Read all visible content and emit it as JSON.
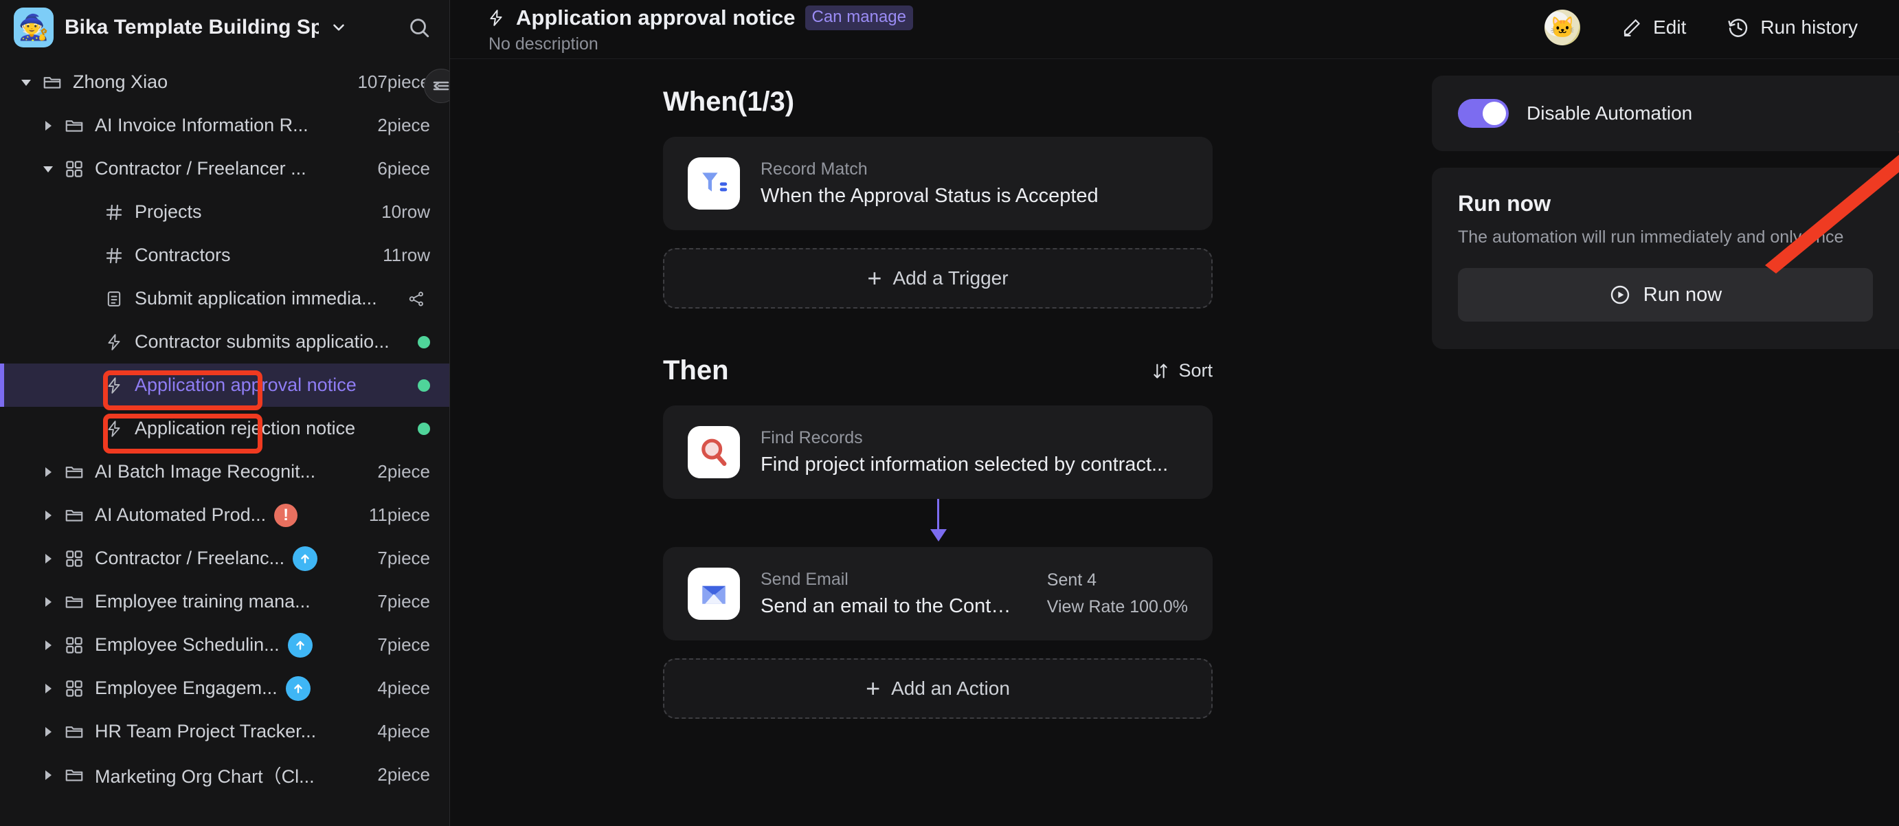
{
  "sidebar": {
    "workspace": {
      "title": "Bika Template Building Sp...",
      "avatar_icon": "wizard-emoji",
      "chevron_icon": "chevron-down-icon",
      "search_icon": "search-icon"
    },
    "collapse_icon": "collapse-sidebar-icon",
    "items": [
      {
        "label": "Zhong Xiao",
        "count": "107piece",
        "icon": "folder-icon",
        "twisty": "expanded",
        "indent": 0
      },
      {
        "label": "AI Invoice Information R...",
        "count": "2piece",
        "icon": "folder-icon",
        "twisty": "collapsed",
        "indent": 1
      },
      {
        "label": "Contractor / Freelancer ...",
        "count": "6piece",
        "icon": "grid-icon",
        "twisty": "expanded",
        "indent": 1
      },
      {
        "label": "Projects",
        "count": "10row",
        "icon": "table-icon",
        "twisty": "none",
        "indent": 2
      },
      {
        "label": "Contractors",
        "count": "11row",
        "icon": "table-icon",
        "twisty": "none",
        "indent": 2
      },
      {
        "label": "Submit application immedia...",
        "count": "",
        "icon": "form-icon",
        "twisty": "none",
        "indent": 2,
        "trailing": "share-icon"
      },
      {
        "label": "Contractor submits applicatio...",
        "count": "",
        "icon": "bolt-icon",
        "twisty": "none",
        "indent": 2,
        "trailing": "green-dot"
      },
      {
        "label": "Application approval notice",
        "count": "",
        "icon": "bolt-icon",
        "twisty": "none",
        "indent": 2,
        "trailing": "green-dot",
        "active": true,
        "highlighted": true
      },
      {
        "label": "Application rejection notice",
        "count": "",
        "icon": "bolt-icon",
        "twisty": "none",
        "indent": 2,
        "trailing": "green-dot",
        "highlighted": true
      },
      {
        "label": "AI Batch Image Recognit...",
        "count": "2piece",
        "icon": "folder-icon",
        "twisty": "collapsed",
        "indent": 1
      },
      {
        "label": "AI Automated Prod...",
        "count": "11piece",
        "icon": "folder-icon",
        "twisty": "collapsed",
        "indent": 1,
        "badge": "warn"
      },
      {
        "label": "Contractor / Freelanc...",
        "count": "7piece",
        "icon": "grid-icon",
        "twisty": "collapsed",
        "indent": 1,
        "badge": "up"
      },
      {
        "label": "Employee training mana...",
        "count": "7piece",
        "icon": "folder-icon",
        "twisty": "collapsed",
        "indent": 1
      },
      {
        "label": "Employee Schedulin...",
        "count": "7piece",
        "icon": "grid-icon",
        "twisty": "collapsed",
        "indent": 1,
        "badge": "up"
      },
      {
        "label": "Employee Engagem...",
        "count": "4piece",
        "icon": "grid-icon",
        "twisty": "collapsed",
        "indent": 1,
        "badge": "up"
      },
      {
        "label": "HR Team Project Tracker...",
        "count": "4piece",
        "icon": "folder-icon",
        "twisty": "collapsed",
        "indent": 1
      },
      {
        "label": "Marketing Org Chart（Cl...",
        "count": "2piece",
        "icon": "folder-icon",
        "twisty": "collapsed",
        "indent": 1
      }
    ]
  },
  "topbar": {
    "bolt_icon": "bolt-icon",
    "title": "Application approval notice",
    "tag": "Can manage",
    "description": "No description",
    "avatar_icon": "cat-avatar",
    "edit_label": "Edit",
    "edit_icon": "pencil-icon",
    "history_label": "Run history",
    "history_icon": "clock-history-icon"
  },
  "flow": {
    "when": {
      "title": "When(1/3)",
      "card": {
        "icon": "funnel-filter-icon",
        "subtitle": "Record Match",
        "title": "When the Approval Status is Accepted"
      },
      "add_label": "Add a Trigger",
      "add_icon": "plus-icon"
    },
    "then": {
      "title": "Then",
      "sort_label": "Sort",
      "sort_icon": "sort-icon",
      "cards": [
        {
          "icon": "magnifier-icon",
          "subtitle": "Find Records",
          "title": "Find project information selected by contract...",
          "stat1": "",
          "stat2": ""
        },
        {
          "icon": "envelope-icon",
          "subtitle": "Send Email",
          "title": "Send an email to the Contr...",
          "stat1": "Sent  4",
          "stat2": "View Rate 100.0%"
        }
      ],
      "add_label": "Add an Action",
      "add_icon": "plus-icon"
    }
  },
  "right_panel": {
    "toggle_label": "Disable Automation",
    "toggle_state": "on",
    "run_now_heading": "Run now",
    "run_now_desc": "The automation will run immediately and only once",
    "run_now_button": "Run now",
    "run_now_icon": "play-circle-icon"
  },
  "annotations": {
    "arrow_color": "#ef3b22",
    "highlight_color": "#f03a20",
    "arrow_icon": "pointer-arrow-annotation"
  },
  "colors": {
    "accent_purple": "#7c6cf0",
    "sidebar_bg": "#151516",
    "panel_bg": "#1b1b1d",
    "card_bg": "#1c1c1e",
    "green_dot": "#4fd49a"
  }
}
